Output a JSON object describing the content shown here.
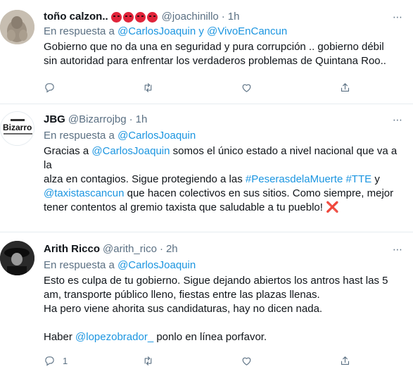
{
  "tweets": [
    {
      "name": "toño calzon..",
      "handle": "@joachinillo",
      "time": "1h",
      "emojis": [
        "angry-face",
        "angry-face",
        "angry-face",
        "angry-face"
      ],
      "reply_prefix": "En respuesta a",
      "reply_to": "@CarlosJoaquin y @VivoEnCancun",
      "text_lines": [
        "Gobierno que no da una en seguridad y pura corrupción .. gobierno débil",
        "sin autoridad para enfrentar los verdaderos problemas de Quintana Roo.."
      ],
      "reply_count": "",
      "retweet_count": "",
      "like_count": ""
    },
    {
      "name": "JBG",
      "handle": "@Bizarrojbg",
      "time": "1h",
      "avatar_text": "Bizarro",
      "reply_prefix": "En respuesta a",
      "reply_to": "@CarlosJoaquin",
      "text": {
        "l1a": "Gracias a ",
        "l1_mention": "@CarlosJoaquin",
        "l1b": " somos el único estado a nivel nacional que va a la",
        "l2a": "alza en contagios. Sigue protegiendo a las ",
        "l2_tag1": "#PeserasdelaMuerte",
        "l2_sp": " ",
        "l2_tag2": "#TTE",
        "l2b": " y",
        "l3_mention": "@taxistascancun",
        "l3b": " que hacen colectivos en sus sitios. Como siempre, mejor",
        "l4a": "tener contentos al gremio taxista que saludable a tu pueblo! ",
        "l4_emoji": "❌"
      }
    },
    {
      "name": "Arith Ricco",
      "handle": "@arith_rico",
      "time": "2h",
      "reply_prefix": "En respuesta a",
      "reply_to": "@CarlosJoaquin",
      "text": {
        "l1": "Esto es culpa de tu gobierno. Sigue dejando abiertos los antros hast las 5",
        "l2": "am, transporte público lleno, fiestas entre las plazas llenas.",
        "l3": "Ha pero viene ahorita sus candidaturas, hay no dicen nada.",
        "l5a": "Haber ",
        "l5_mention": "@lopezobrador_",
        "l5b": " ponlo en línea porfavor."
      },
      "reply_count": "1"
    }
  ],
  "separator": "·",
  "more_glyph": "⋯"
}
